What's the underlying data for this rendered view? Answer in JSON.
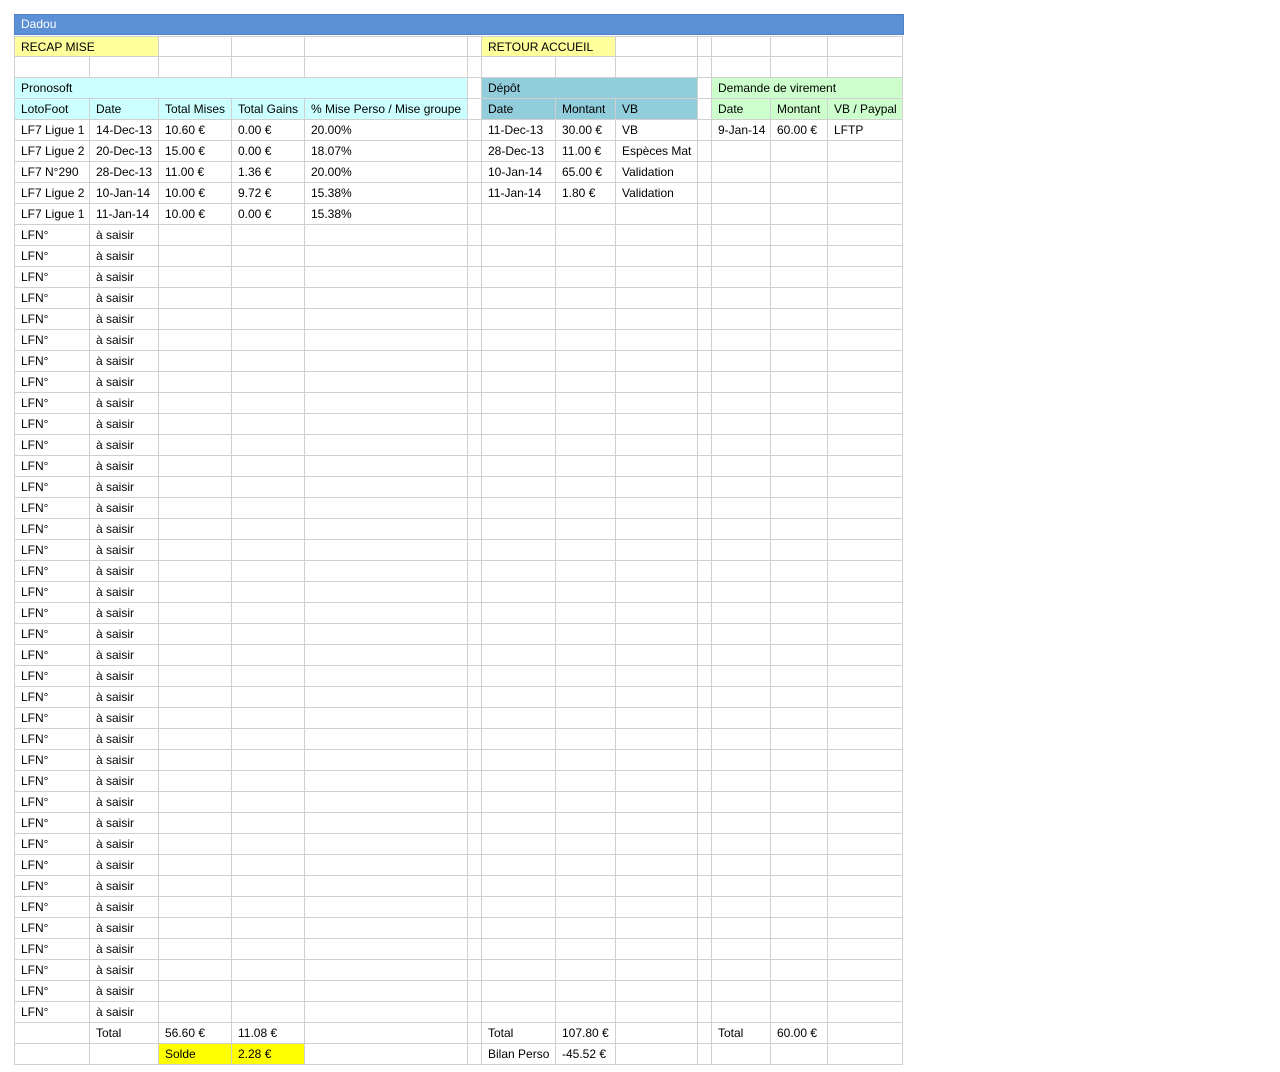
{
  "title": "Dadou",
  "links": {
    "recap": "RECAP MISE",
    "retour": "RETOUR ACCUEIL"
  },
  "sections": {
    "pronosoft": "Pronosoft",
    "depot": "Dépôt",
    "virement": "Demande de virement"
  },
  "pronosoft_headers": [
    "LotoFoot",
    "Date",
    "Total Mises",
    "Total Gains",
    "% Mise Perso / Mise groupe"
  ],
  "depot_headers": [
    "Date",
    "Montant",
    "VB"
  ],
  "virement_headers": [
    "Date",
    "Montant",
    "VB / Paypal"
  ],
  "pronosoft_rows": [
    [
      "LF7 Ligue 1",
      "14-Dec-13",
      "10.60 €",
      "0.00 €",
      "20.00%"
    ],
    [
      "LF7 Ligue 2",
      "20-Dec-13",
      "15.00 €",
      "0.00 €",
      "18.07%"
    ],
    [
      "LF7 N°290",
      "28-Dec-13",
      "11.00 €",
      "1.36 €",
      "20.00%"
    ],
    [
      "LF7 Ligue 2",
      "10-Jan-14",
      "10.00 €",
      "9.72 €",
      "15.38%"
    ],
    [
      "LF7 Ligue 1",
      "11-Jan-14",
      "10.00 €",
      "0.00 €",
      "15.38%"
    ]
  ],
  "placeholder": {
    "lf": "LFN°",
    "date": "à saisir",
    "count": 38
  },
  "depot_rows": [
    [
      "11-Dec-13",
      "30.00 €",
      "VB"
    ],
    [
      "28-Dec-13",
      "11.00 €",
      "Espèces Mat"
    ],
    [
      "10-Jan-14",
      "65.00 €",
      "Validation"
    ],
    [
      "11-Jan-14",
      "1.80 €",
      "Validation"
    ]
  ],
  "virement_rows": [
    [
      "9-Jan-14",
      "60.00 €",
      "LFTP"
    ]
  ],
  "totals": {
    "label": "Total",
    "mises": "56.60 €",
    "gains": "11.08 €",
    "depot": "107.80 €",
    "virement": "60.00 €"
  },
  "solde": {
    "label": "Solde",
    "value": "2.28 €"
  },
  "bilan": {
    "label": "Bilan Perso",
    "value": "-45.52 €"
  },
  "colors": {
    "title_bar": "#5b8fd6",
    "link_yellow": "#ffff9c",
    "solde_yellow": "#ffff00",
    "pronosoft_cyan": "#ccffff",
    "depot_blue": "#92cddc",
    "virement_green": "#ccffcc"
  }
}
